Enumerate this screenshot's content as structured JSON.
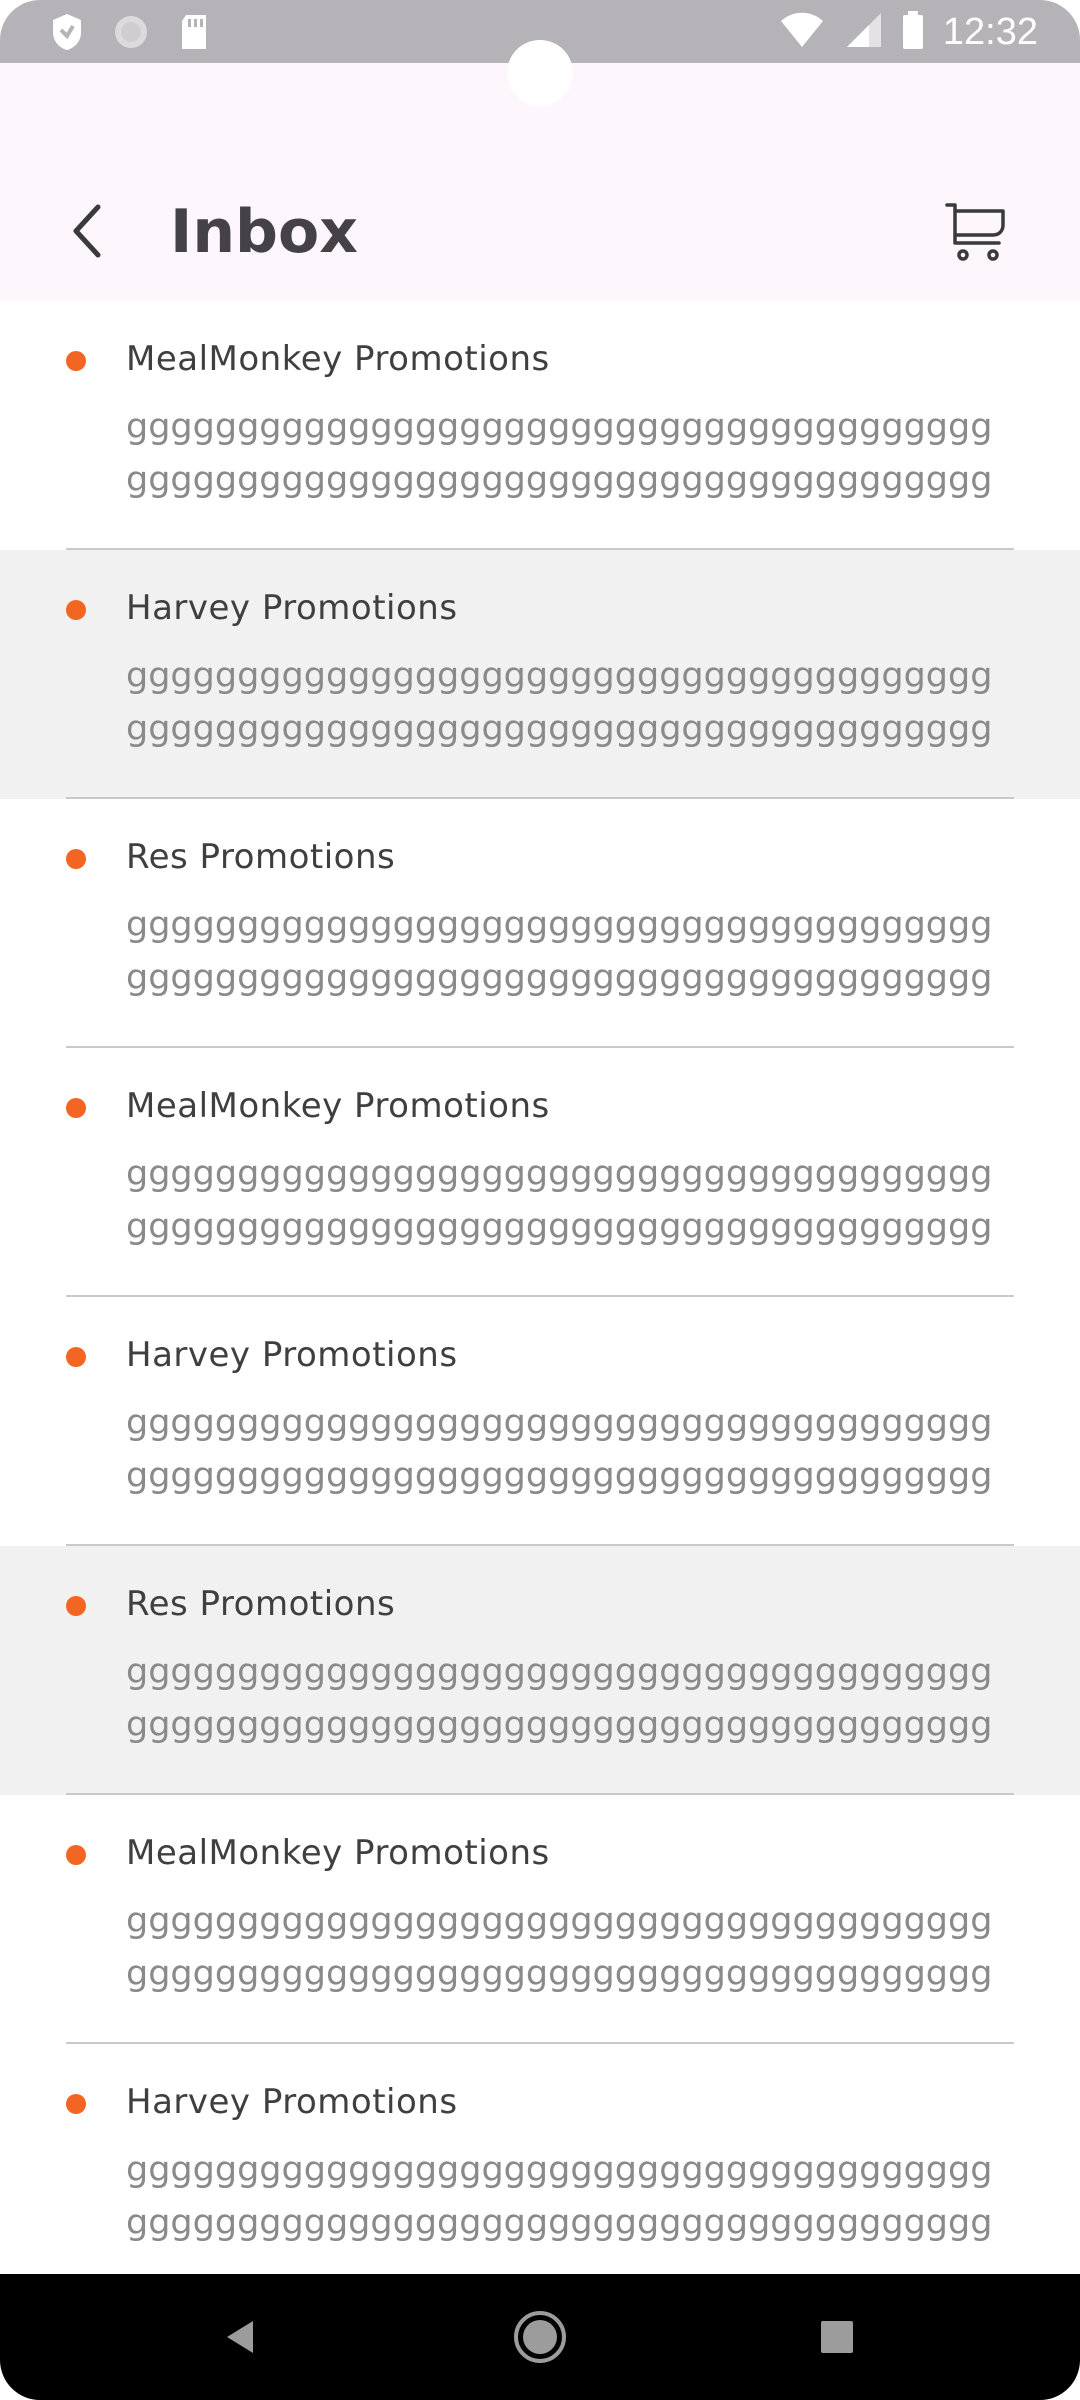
{
  "status_bar": {
    "time": "12:32",
    "icons": [
      "shield-icon",
      "circle-icon",
      "sd-card-icon",
      "wifi-icon",
      "signal-icon",
      "battery-icon"
    ]
  },
  "header": {
    "title": "Inbox",
    "back_icon": "chevron-left-icon",
    "cart_icon": "cart-icon"
  },
  "colors": {
    "accent_dot": "#f26522",
    "header_bg": "#fdf6fd",
    "status_bar_bg": "#b6b3b8"
  },
  "messages": [
    {
      "sender": "MealMonkey Promotions",
      "preview": "gggggggggggggggggggggggggggggggggggggggggggggggggggggggggggggggggggggggggggggggggggggggggg",
      "highlighted": false
    },
    {
      "sender": "Harvey Promotions",
      "preview": "gggggggggggggggggggggggggggggggggggggggggggggggggggggggggggggggggggggggggggggggggggggggggg",
      "highlighted": true
    },
    {
      "sender": "Res Promotions",
      "preview": "gggggggggggggggggggggggggggggggggggggggggggggggggggggggggggggggggggggggggggggggggggggggggg",
      "highlighted": false
    },
    {
      "sender": "MealMonkey Promotions",
      "preview": "gggggggggggggggggggggggggggggggggggggggggggggggggggggggggggggggggggggggggggggggggggggggggg",
      "highlighted": false
    },
    {
      "sender": "Harvey Promotions",
      "preview": "gggggggggggggggggggggggggggggggggggggggggggggggggggggggggggggggggggggggggggggggggggggggggg",
      "highlighted": false
    },
    {
      "sender": "Res Promotions",
      "preview": "gggggggggggggggggggggggggggggggggggggggggggggggggggggggggggggggggggggggggggggggggggggggggg",
      "highlighted": true
    },
    {
      "sender": "MealMonkey Promotions",
      "preview": "gggggggggggggggggggggggggggggggggggggggggggggggggggggggggggggggggggggggggggggggggggggggggg",
      "highlighted": false
    },
    {
      "sender": "Harvey Promotions",
      "preview": "gggggggggggggggggggggggggggggggggggggggggggggggggggggggggggggggggggggggggggggggggggggggggg",
      "highlighted": false
    }
  ],
  "nav_bar": {
    "buttons": [
      "back-triangle-icon",
      "home-circle-icon",
      "recents-square-icon"
    ]
  }
}
